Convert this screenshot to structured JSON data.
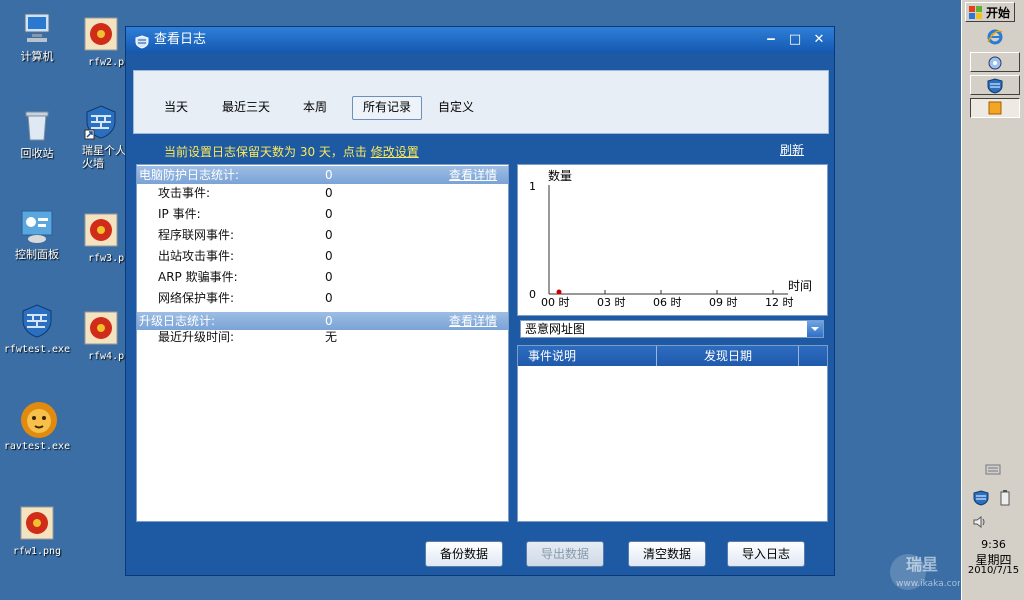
{
  "desktop": {
    "icons": [
      {
        "label": "计算机"
      },
      {
        "label": "回收站"
      },
      {
        "label": "控制面板"
      },
      {
        "label": "rfwtest.exe"
      },
      {
        "label": "ravtest.exe"
      },
      {
        "label": "rfw1.png"
      },
      {
        "label": "rfw2.p"
      },
      {
        "label": "瑞星个人\n火墙"
      },
      {
        "label": "rfw3.p"
      },
      {
        "label": "rfw4.p"
      }
    ]
  },
  "window": {
    "title": "查看日志",
    "minimize": "‒",
    "maximize": "□",
    "close": "✕"
  },
  "filters": {
    "tabs": [
      "当天",
      "最近三天",
      "本周",
      "所有记录",
      "自定义"
    ],
    "active": "所有记录"
  },
  "retention": {
    "text": "当前设置日志保留天数为 30 天，点击 ",
    "link": "修改设置"
  },
  "refresh": "刷新",
  "protection": {
    "title": "电脑防护日志统计:",
    "value": "0",
    "detail": "查看详情",
    "rows": [
      {
        "name": "攻击事件:",
        "value": "0"
      },
      {
        "name": "IP 事件:",
        "value": "0"
      },
      {
        "name": "程序联网事件:",
        "value": "0"
      },
      {
        "name": "出站攻击事件:",
        "value": "0"
      },
      {
        "name": "ARP 欺骗事件:",
        "value": "0"
      },
      {
        "name": "网络保护事件:",
        "value": "0"
      }
    ]
  },
  "upgrade": {
    "title": "升级日志统计:",
    "value": "0",
    "detail": "查看详情",
    "rows": [
      {
        "name": "最近升级时间:",
        "value": "无"
      }
    ]
  },
  "chart_data": {
    "type": "line",
    "ylabel": "数量",
    "xlabel": "时间",
    "ylim": [
      0,
      1
    ],
    "yticks": [
      "0",
      "1"
    ],
    "xticks": [
      "00 时",
      "03 时",
      "06 时",
      "09 时",
      "12 时"
    ],
    "series": [
      {
        "values": [
          0
        ]
      }
    ],
    "series_color": "#cc0000"
  },
  "combo": {
    "selected": "恶意网址图"
  },
  "grid": {
    "columns": [
      "事件说明",
      "发现日期"
    ]
  },
  "buttons": {
    "backup": "备份数据",
    "export": "导出数据",
    "clear": "清空数据",
    "import": "导入日志"
  },
  "taskbar": {
    "start": "开始",
    "time": "9:36",
    "weekday": "星期四",
    "date": "2010/7/15"
  },
  "watermark": {
    "brand": "瑞星",
    "url": "www.ikaka.com"
  },
  "colors": {
    "accent": "#1d5aa3",
    "notice": "#ffe95a"
  }
}
